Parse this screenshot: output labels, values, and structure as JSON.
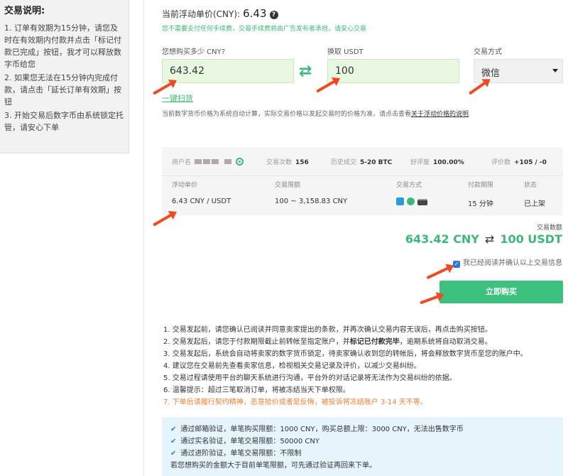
{
  "instructions": {
    "title": "交易说明:",
    "items": [
      "1. 订单有效期为15分钟，请您及时在有效期内付款并点击「标记付款已完成」按钮，我才可以释放数字币给您",
      "2. 如果您无法在15分钟内完成付款，请点击「延长订单有效期」按钮",
      "3. 开始交易后数字币由系统锁定托管，请安心下单"
    ]
  },
  "price": {
    "label": "当前浮动单价(CNY):",
    "value": "6.43",
    "fee_note": "您不需要支付任何手续费，交易手续费将由广告发布者承担，请安心交易"
  },
  "form": {
    "cny_label": "您想购买多少 CNY?",
    "cny_value": "643.42",
    "usdt_label": "换取 USDT",
    "usdt_value": "100",
    "method_label": "交易方式",
    "method_value": "微信",
    "quick_buy": "一键扫货",
    "calc_note": "当前数字货币价格为系统自动计算，实际交易价格以发起交易时的价格为准，请点击查看",
    "calc_link": "关于浮动价格的说明"
  },
  "seller": {
    "user_label": "用户名",
    "trades_label": "交易次数",
    "trades_value": "156",
    "history_label": "历史成交",
    "history_value": "5-20 BTC",
    "rating_label": "好评度",
    "rating_value": "100.00%",
    "reviews_label": "评价数",
    "reviews_value": "+105 / -0",
    "headers": [
      "浮动单价",
      "交易限额",
      "交易方式",
      "付款期限",
      "状态"
    ],
    "unit_price": "6.43 CNY / USDT",
    "limit": "100 ~ 3,158.83 CNY",
    "pay_icons": [
      "alipay-icon",
      "wechat-icon",
      "bank-card-icon"
    ],
    "deadline": "15 分钟",
    "status": "已上架"
  },
  "deal": {
    "label": "交易数额",
    "cny": "643.42 CNY",
    "arrow": "⇄",
    "usdt": "100 USDT",
    "agree_text": "我已经阅读并确认以上交易信息",
    "buy_button": "立即购买"
  },
  "rules": {
    "r1": "1. 交易发起前，请您确认已阅读并同意卖家提出的条款，并再次确认交易内容无误后，再点击购买按钮。",
    "r2a": "2. 交易发起后，请您于付款期限截止前转帐至指定账户，并",
    "r2b": "标记已付款完毕",
    "r2c": "，逾期系统将自动取消交易。",
    "r3": "3. 交易发起后，系统会自动将卖家的数字货币锁定，待卖家确认收到您的转帐后，将会释放数字货币至您的账户中。",
    "r4": "4. 建议您在交易前先查看卖家信息，检视相关交易记录及评价，以减少交易纠纷。",
    "r5": "5. 交易过程请使用平台的聊天系统进行沟通，平台外的对话记录将无法作为交易纠纷的依据。",
    "r6": "6. 温馨提示：超过三笔取消订单，将被冻结当天下单权限。",
    "r7": "7. 下单后请履行契约精神，恶意拾价或者是反悔，被投诉将冻结账户 3-14 天不等。"
  },
  "limits": {
    "l1": "通过邮箱验证，单笔购买限额：1000 CNY，购买总额上限：3000 CNY，无法出售数字币",
    "l2": "通过实名验证，单笔交易限额：50000 CNY",
    "l3": "通过进阶验证，单笔交易限额：不限制",
    "l4": "若您想购买的金额大于目前单笔限额，可先通过验证再回来下单。"
  },
  "colors": {
    "accent_green": "#3cb878",
    "annotation_red": "#ef4a23",
    "warning_orange": "#f08133"
  }
}
